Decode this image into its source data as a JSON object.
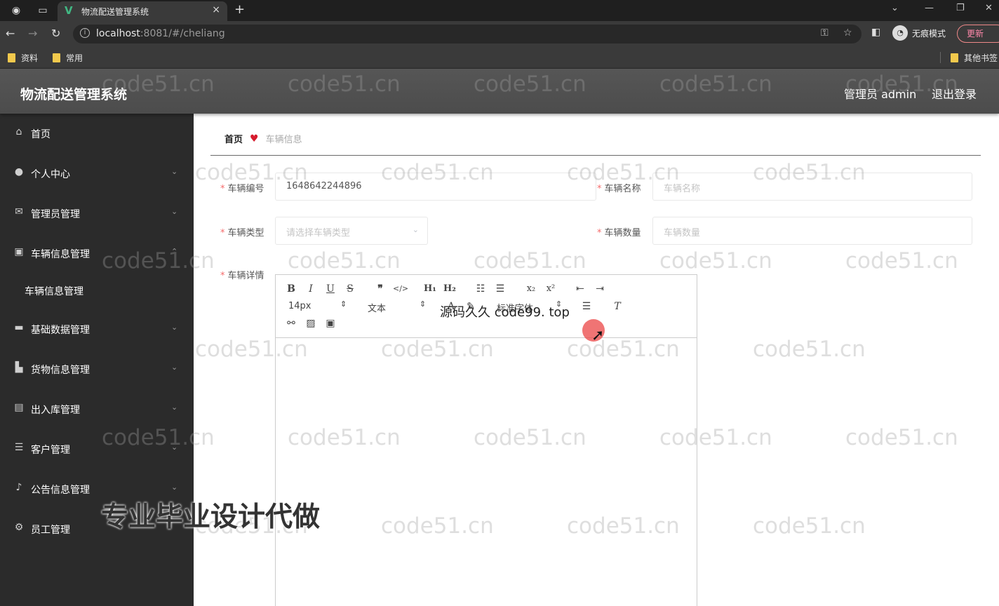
{
  "browser": {
    "tab_title": "物流配送管理系统",
    "tab_close": "×",
    "new_tab": "+",
    "url_host": "localhost",
    "url_rest": ":8081/#/cheliang",
    "incognito_label": "无痕模式",
    "update_label": "更新",
    "bookmarks": [
      "资料",
      "常用"
    ],
    "other_bookmarks": "其他书签"
  },
  "header": {
    "app_title": "物流配送管理系统",
    "user": "管理员 admin",
    "logout": "退出登录"
  },
  "sidebar": {
    "items": [
      {
        "label": "首页",
        "icon": "home-icon"
      },
      {
        "label": "个人中心",
        "icon": "user-icon"
      },
      {
        "label": "管理员管理",
        "icon": "mail-icon"
      },
      {
        "label": "车辆信息管理",
        "icon": "picture-icon"
      },
      {
        "label": "基础数据管理",
        "icon": "monitor-icon"
      },
      {
        "label": "货物信息管理",
        "icon": "shopping-icon"
      },
      {
        "label": "出入库管理",
        "icon": "chat-icon"
      },
      {
        "label": "客户管理",
        "icon": "list-icon"
      },
      {
        "label": "公告信息管理",
        "icon": "bell-icon"
      },
      {
        "label": "员工管理",
        "icon": "gear-icon"
      }
    ],
    "submenu": [
      "车辆信息管理"
    ]
  },
  "breadcrumb": {
    "home": "首页",
    "current": "车辆信息"
  },
  "form": {
    "vehicle_no_label": "车辆编号",
    "vehicle_no_value": "1648642244896",
    "vehicle_name_label": "车辆名称",
    "vehicle_name_placeholder": "车辆名称",
    "vehicle_type_label": "车辆类型",
    "vehicle_type_placeholder": "请选择车辆类型",
    "vehicle_count_label": "车辆数量",
    "vehicle_count_placeholder": "车辆数量",
    "vehicle_detail_label": "车辆详情"
  },
  "editor": {
    "font_size": "14px",
    "heading": "文本",
    "font_family": "标准字体"
  },
  "overlays": {
    "source": "源码久久 code99. top",
    "ad": "专业毕业设计代做",
    "watermark": "code51.cn"
  }
}
